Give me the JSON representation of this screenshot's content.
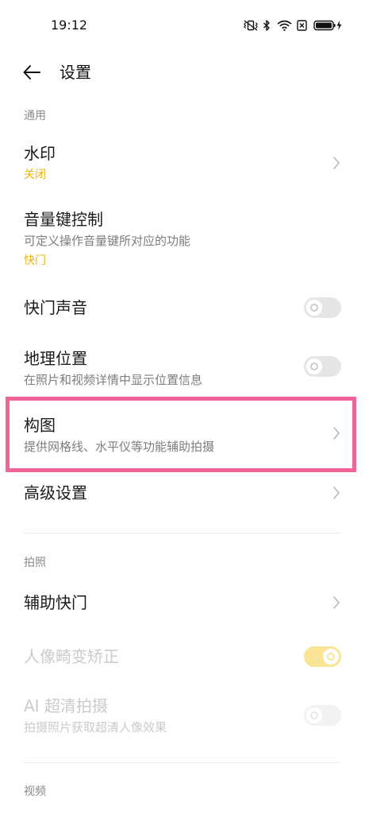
{
  "status_bar": {
    "time": "19:12",
    "icons": [
      "vibrate-mute-icon",
      "bluetooth-icon",
      "wifi-icon",
      "sim-no-signal-icon",
      "battery-charging-icon"
    ]
  },
  "header": {
    "title": "设置",
    "back_icon": "arrow-left-icon"
  },
  "sections": {
    "general": "通用",
    "photo": "拍照",
    "video": "视频"
  },
  "items": {
    "watermark": {
      "title": "水印",
      "value": "关闭"
    },
    "volume_key": {
      "title": "音量键控制",
      "desc": "可定义操作音量键所对应的功能",
      "value": "快门"
    },
    "shutter_sound": {
      "title": "快门声音",
      "toggle": false
    },
    "location": {
      "title": "地理位置",
      "desc": "在照片和视频详情中显示位置信息",
      "toggle": false
    },
    "composition": {
      "title": "构图",
      "desc": "提供网格线、水平仪等功能辅助拍摄"
    },
    "advanced": {
      "title": "高级设置"
    },
    "assist_shutter": {
      "title": "辅助快门"
    },
    "portrait_distortion": {
      "title": "人像畸变矫正",
      "toggle": true,
      "disabled": true
    },
    "ai_hd": {
      "title": "AI 超清拍摄",
      "desc": "拍摄照片获取超清人像效果",
      "toggle": false,
      "disabled": true
    }
  },
  "colors": {
    "accent": "#e9b60a",
    "toggle_on": "#f5c518",
    "toggle_off": "#e6e6e6",
    "highlight": "#f0649a",
    "text_primary": "#1a1a1a",
    "text_secondary": "#7d7d7d",
    "text_disabled": "#cbcbcb"
  }
}
